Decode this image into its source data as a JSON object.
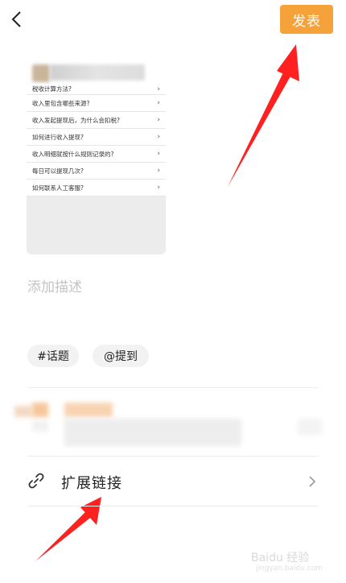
{
  "header": {
    "publish_label": "发表"
  },
  "preview": {
    "top_partial": "税收计算方法?",
    "items": [
      "收入里包含哪些来源?",
      "收入发起提现后，为什么会扣税?",
      "如何进行收入提现?",
      "收入明细就按什么规则记录的?",
      "每日可以提现几次?",
      "如何联系人工客服?"
    ],
    "chevron": "›"
  },
  "description": {
    "placeholder": "添加描述"
  },
  "tags": {
    "topic": "#话题",
    "mention": "@提到"
  },
  "link": {
    "label": "扩展链接"
  },
  "watermark": {
    "text": "Baidu 经验",
    "sub": "jingyan.baidu.com"
  },
  "colors": {
    "accent": "#f5a23a",
    "arrow": "#ff2020"
  }
}
